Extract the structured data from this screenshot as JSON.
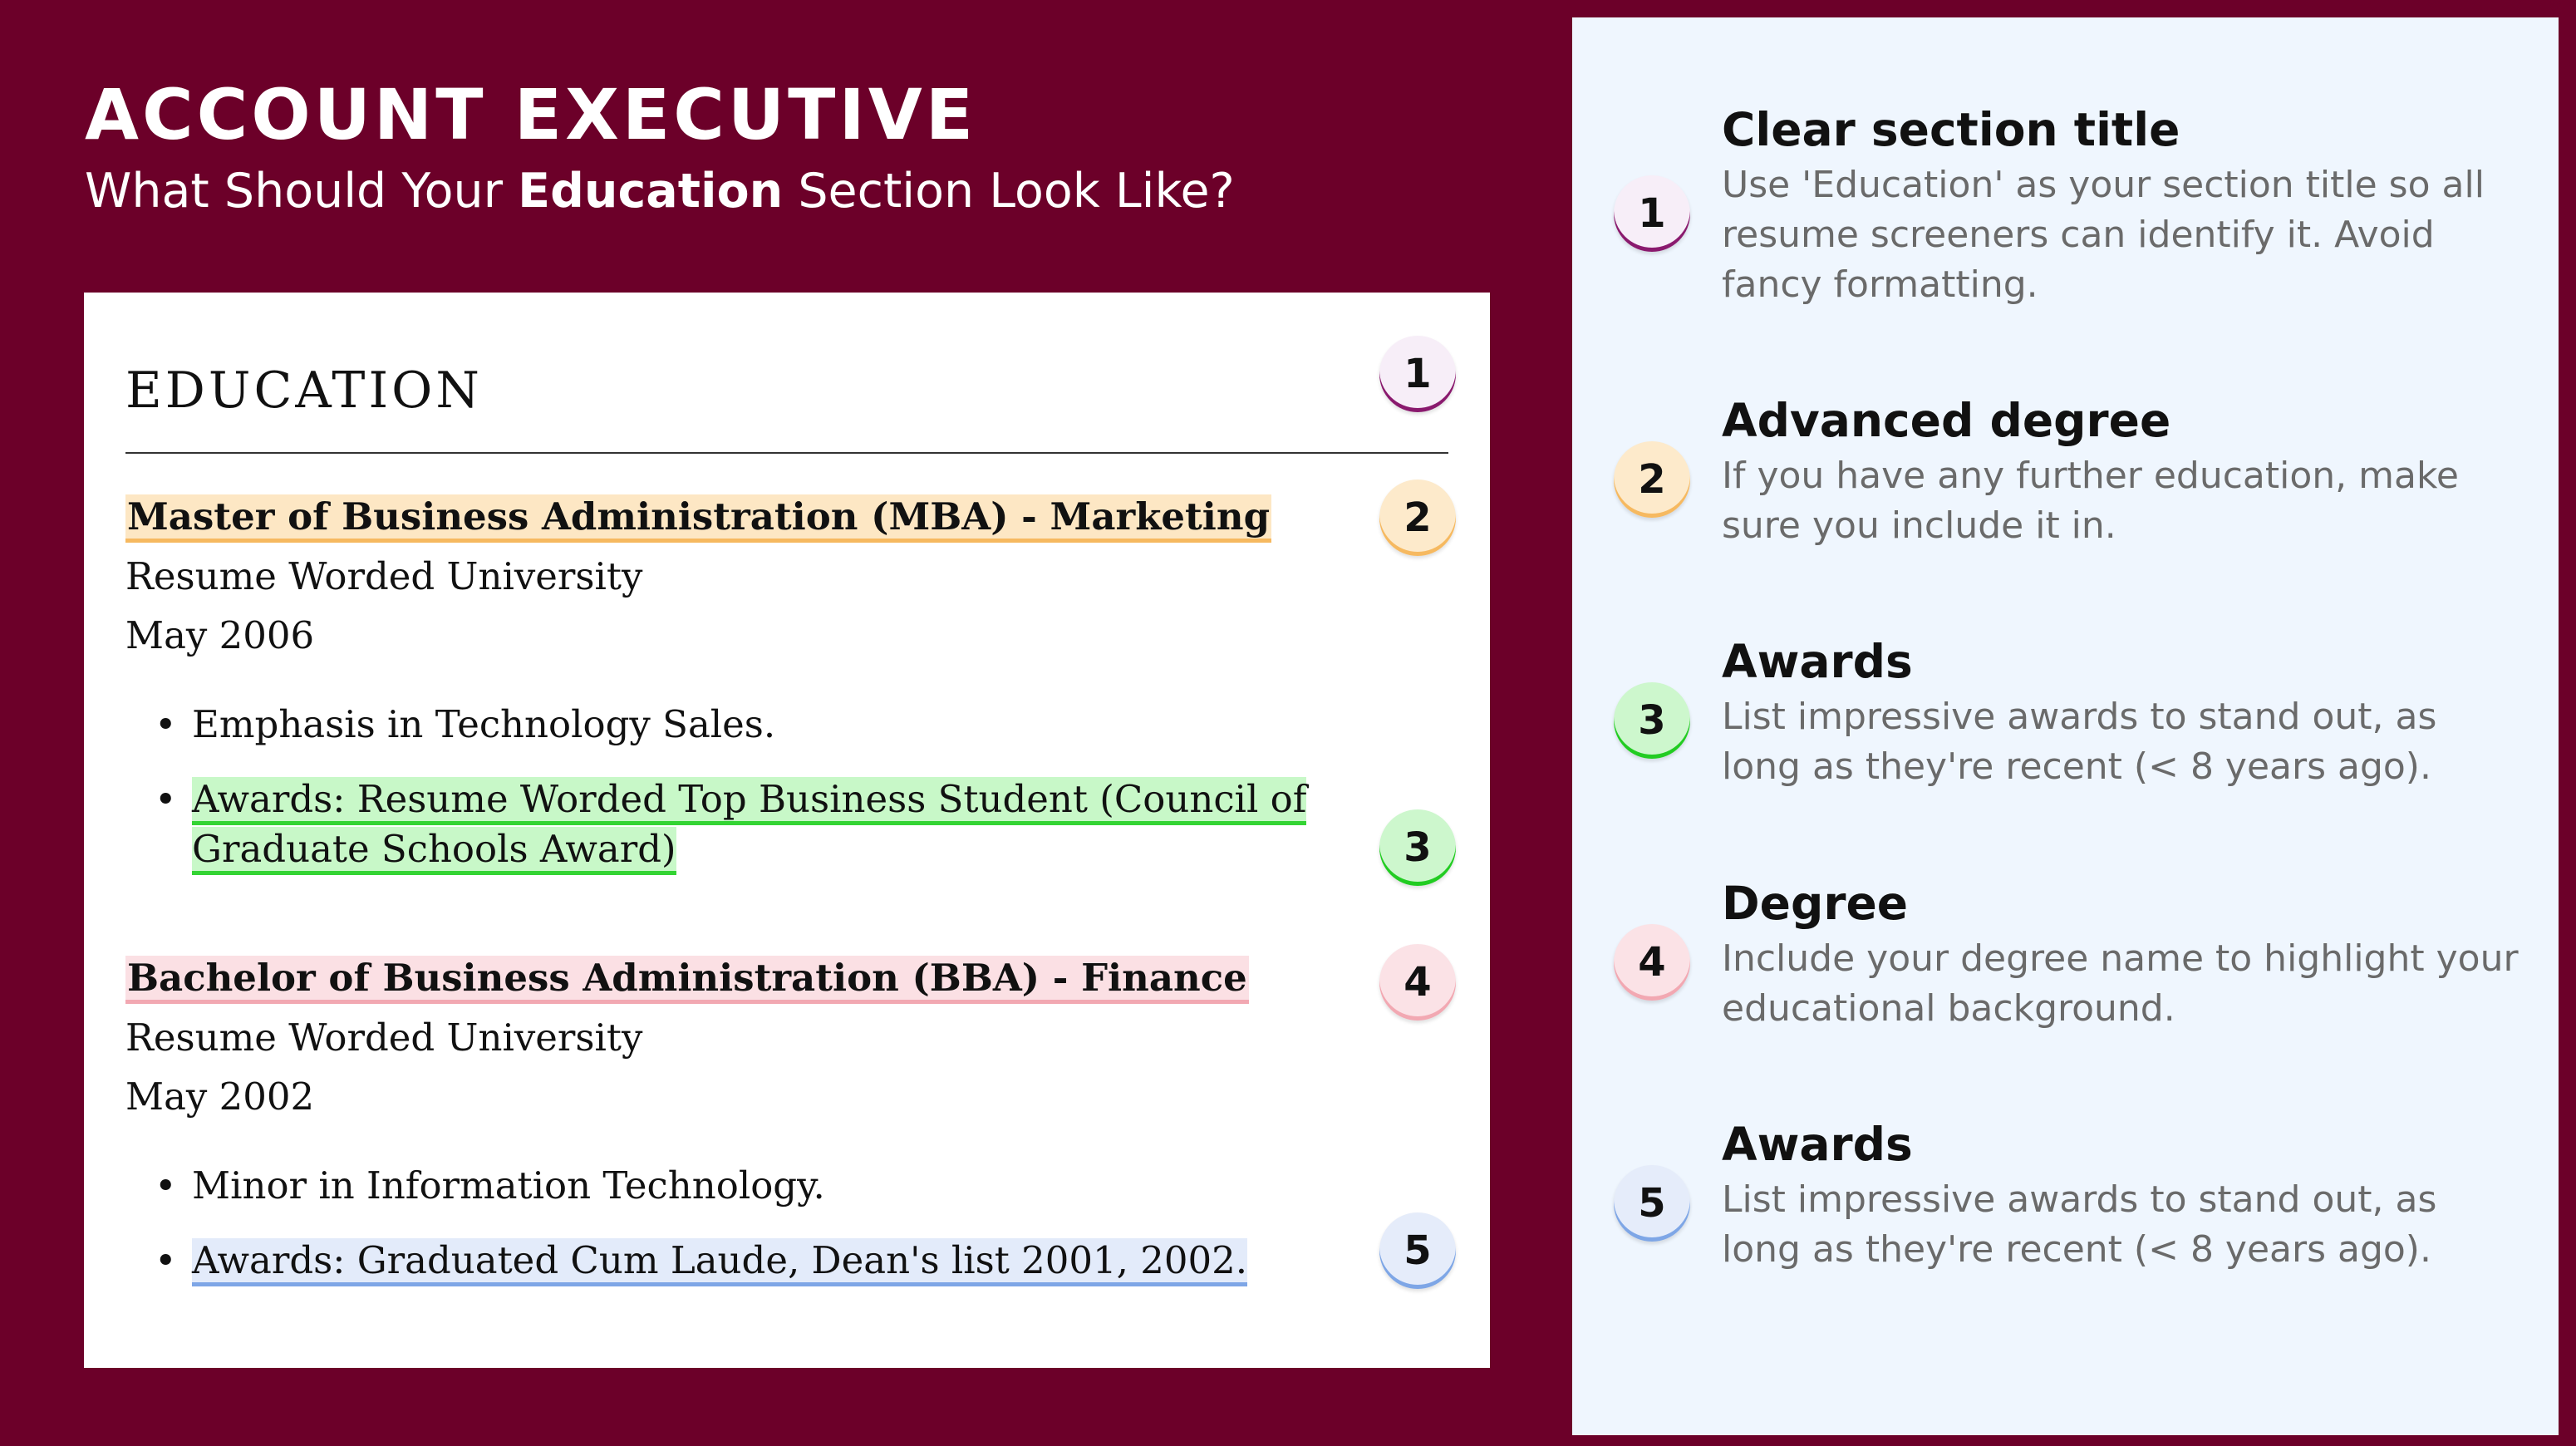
{
  "header": {
    "title": "ACCOUNT EXECUTIVE",
    "subtitle_pre": "What Should Your ",
    "subtitle_bold": "Education",
    "subtitle_post": " Section Look Like?"
  },
  "resume": {
    "heading": "EDUCATION",
    "entries": [
      {
        "degree": "Master of Business Administration (MBA) - Marketing",
        "school": "Resume Worded University",
        "date": "May 2006",
        "bullets": [
          "Emphasis in Technology Sales.",
          "Awards: Resume Worded Top Business Student (Council of Graduate Schools Award)"
        ]
      },
      {
        "degree": "Bachelor of Business Administration (BBA) - Finance",
        "school": "Resume Worded University",
        "date": "May 2002",
        "bullets": [
          "Minor in Information Technology.",
          "Awards: Graduated Cum Laude, Dean's list 2001, 2002."
        ]
      }
    ],
    "bullet_glyph": "•"
  },
  "badges": [
    "1",
    "2",
    "3",
    "4",
    "5"
  ],
  "badge_colors": {
    "1": {
      "fill": "#f7eef8",
      "accent": "#8a1a6e"
    },
    "2": {
      "fill": "#fdeacb",
      "accent": "#f6b960"
    },
    "3": {
      "fill": "#cdf7cd",
      "accent": "#22cc22"
    },
    "4": {
      "fill": "#fbe2e6",
      "accent": "#f2a8b2"
    },
    "5": {
      "fill": "#e5ecfa",
      "accent": "#7ea6e6"
    }
  },
  "tips": [
    {
      "number": "1",
      "title": "Clear section title",
      "description": "Use 'Education' as your section title so all resume screeners can identify it. Avoid fancy formatting."
    },
    {
      "number": "2",
      "title": "Advanced degree",
      "description": "If you have any further education, make sure you include it in."
    },
    {
      "number": "3",
      "title": "Awards",
      "description": "List impressive awards to stand out, as long as they're recent (< 8 years ago)."
    },
    {
      "number": "4",
      "title": "Degree",
      "description": "Include your degree name to highlight your educational background."
    },
    {
      "number": "5",
      "title": "Awards",
      "description": "List impressive awards to stand out, as long as they're recent (< 8 years ago)."
    }
  ],
  "colors": {
    "background": "#6c0029",
    "right_panel": "#eff6fe",
    "card": "#ffffff"
  }
}
